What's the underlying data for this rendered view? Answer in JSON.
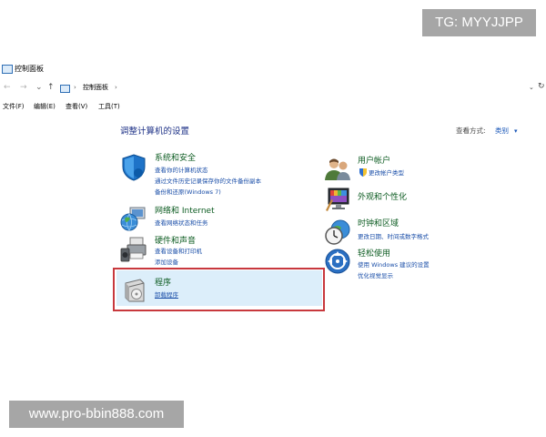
{
  "watermarks": {
    "top": "TG: MYYJJPP",
    "bottom": "www.pro-bbin888.com"
  },
  "window": {
    "title": "控制面板"
  },
  "nav": {
    "back": "←",
    "forward": "→",
    "history": "⌄",
    "up": "↑",
    "refresh": "↻",
    "dropdown": "⌄"
  },
  "address": {
    "path": "控制面板",
    "sep1": "›",
    "sep2": "›"
  },
  "menu": {
    "file": "文件(F)",
    "edit": "编辑(E)",
    "view": "查看(V)",
    "tools": "工具(T)"
  },
  "content": {
    "heading": "调整计算机的设置",
    "view_label": "查看方式:",
    "view_value": "类别",
    "view_caret": "▾"
  },
  "categories": {
    "system": {
      "title": "系统和安全",
      "links": [
        "查看你的计算机状态",
        "通过文件历史记录保存你的文件备份副本",
        "备份和还原(Windows 7)"
      ]
    },
    "network": {
      "title": "网络和 Internet",
      "links": [
        "查看网络状态和任务"
      ]
    },
    "hardware": {
      "title": "硬件和声音",
      "links": [
        "查看设备和打印机",
        "添加设备"
      ]
    },
    "programs": {
      "title": "程序",
      "links": [
        "卸载程序"
      ]
    },
    "accounts": {
      "title": "用户帐户",
      "links": [
        "更改帐户类型"
      ]
    },
    "appearance": {
      "title": "外观和个性化",
      "links": []
    },
    "clock": {
      "title": "时钟和区域",
      "links": [
        "更改日期、时间或数字格式"
      ]
    },
    "ease": {
      "title": "轻松使用",
      "links": [
        "使用 Windows 建议的设置",
        "优化视觉显示"
      ]
    }
  },
  "colors": {
    "heading": "#1e3287",
    "category_title": "#0d5c22",
    "link": "#1a4ea8",
    "highlight_border": "#c8383d",
    "highlight_fill": "#dceefa"
  }
}
